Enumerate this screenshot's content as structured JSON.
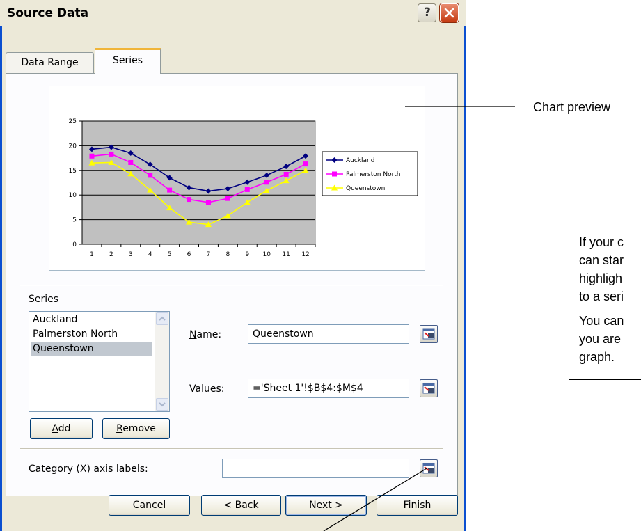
{
  "dialog": {
    "title": "Source Data",
    "help_label": "?"
  },
  "tabs": [
    {
      "label": "Data Range"
    },
    {
      "label": "Series"
    }
  ],
  "chart_data": {
    "type": "line",
    "x": [
      1,
      2,
      3,
      4,
      5,
      6,
      7,
      8,
      9,
      10,
      11,
      12
    ],
    "ylim": [
      0,
      25
    ],
    "yticks": [
      0,
      5,
      10,
      15,
      20,
      25
    ],
    "grid": true,
    "legend": "right",
    "series": [
      {
        "name": "Auckland",
        "color": "#000080",
        "marker": "diamond",
        "values": [
          19.3,
          19.7,
          18.5,
          16.2,
          13.5,
          11.5,
          10.8,
          11.3,
          12.6,
          14.0,
          15.8,
          17.9
        ]
      },
      {
        "name": "Palmerston North",
        "color": "#ff00ff",
        "marker": "square",
        "values": [
          17.9,
          18.3,
          16.6,
          14.0,
          11.0,
          9.1,
          8.5,
          9.3,
          11.1,
          12.6,
          14.2,
          16.3
        ]
      },
      {
        "name": "Queenstown",
        "color": "#ffff00",
        "marker": "triangle",
        "values": [
          16.5,
          16.6,
          14.3,
          11.0,
          7.4,
          4.5,
          4.0,
          5.8,
          8.5,
          10.9,
          12.9,
          15.0
        ]
      }
    ]
  },
  "series_panel": {
    "group_label": "Series",
    "items": [
      "Auckland",
      "Palmerston North",
      "Queenstown"
    ],
    "selected": "Queenstown",
    "add_label": "Add",
    "remove_label": "Remove",
    "name_label": "Name:",
    "name_value": "Queenstown",
    "values_label": "Values:",
    "values_value": "='Sheet 1'!$B$4:$M$4"
  },
  "category_label": "Category (X) axis labels:",
  "category_value": "",
  "footer": {
    "cancel": "Cancel",
    "back": "< Back",
    "next": "Next >",
    "finish": "Finish"
  },
  "annotations": {
    "chart_preview": "Chart preview",
    "callout_lines": [
      "If your c",
      "can star",
      "highligh",
      "to a seri",
      "You can",
      "you are",
      "graph."
    ]
  }
}
